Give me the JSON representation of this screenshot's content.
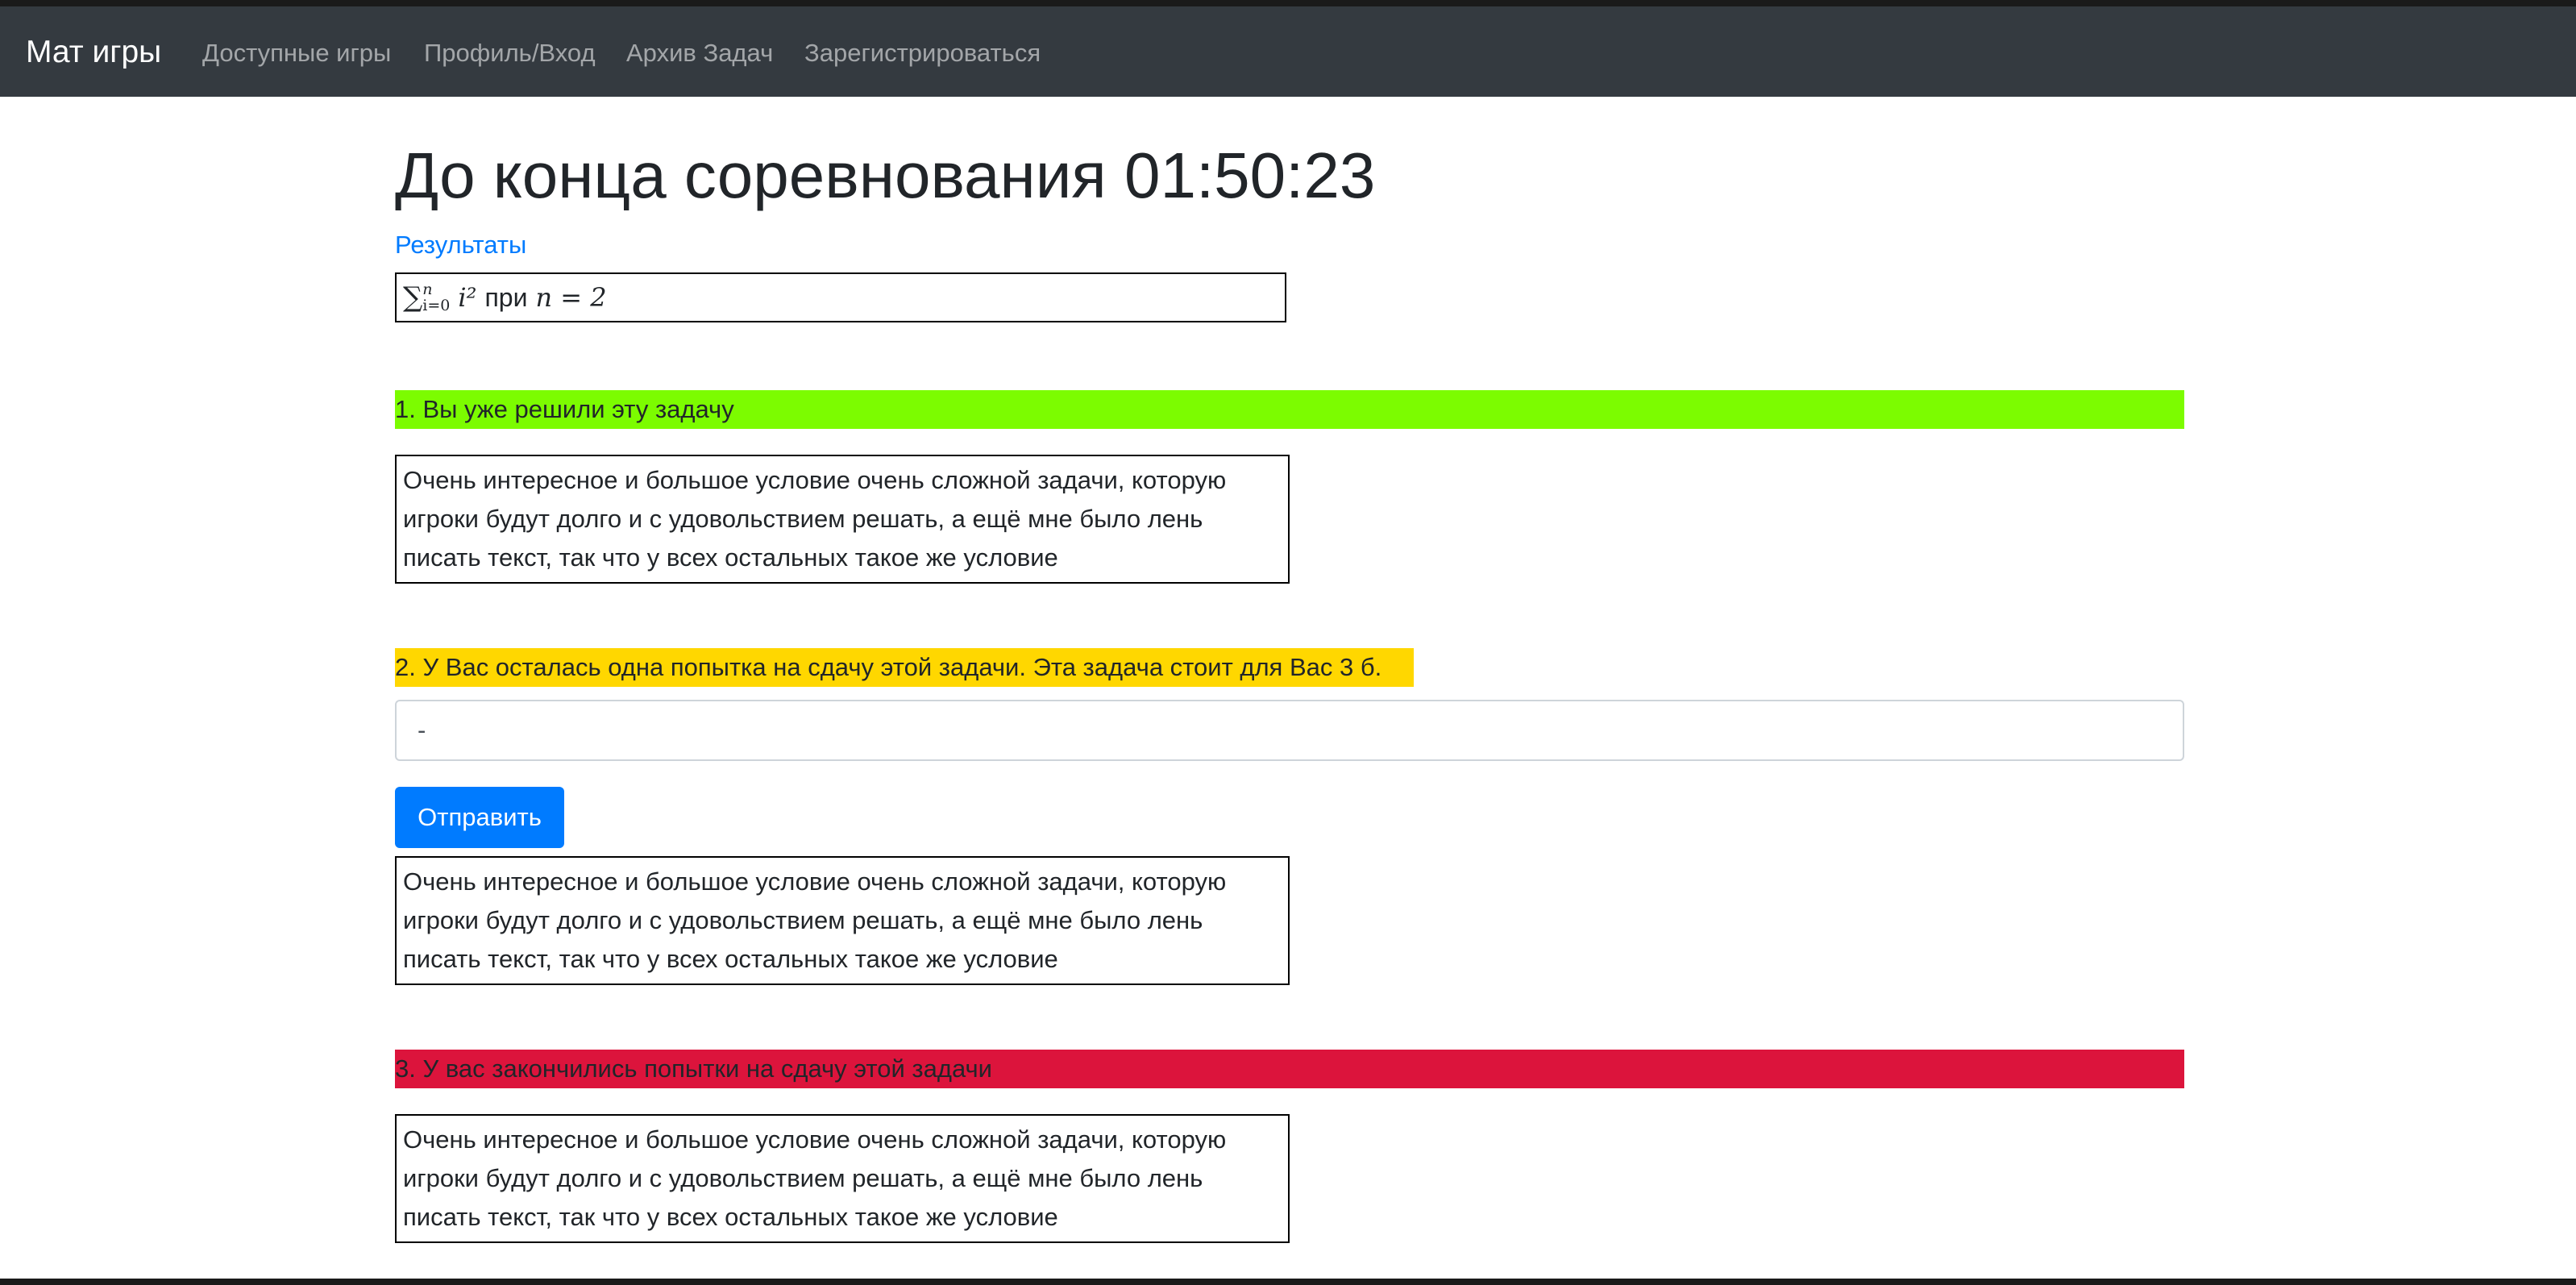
{
  "navbar": {
    "brand": "Мат игры",
    "links": [
      "Доступные игры",
      "Профиль/Вход",
      "Архив Задач",
      "Зарегистрироваться"
    ]
  },
  "countdown": {
    "label": "До конца соревнования 01:50:23"
  },
  "results_link": "Результаты",
  "formula": {
    "sigma": "∑",
    "upper": "n",
    "lower": "i=0",
    "term": "i²",
    "mid": "при",
    "condition": "n = 2"
  },
  "tasks": [
    {
      "status": "1. Вы уже решили эту задачу",
      "status_color": "#7cfc00",
      "text": "Очень интересное и большое условие очень сложной задачи, которую игроки будут долго и с удовольствием решать, а ещё мне было лень писать текст, так что у всех остальных такое же условие"
    },
    {
      "status": "2. У Вас осталась одна попытка на сдачу этой задачи. Эта задача стоит для Вас 3 б.",
      "status_color": "#ffd700",
      "answer_value": "-",
      "submit_label": "Отправить",
      "text": "Очень интересное и большое условие очень сложной задачи, которую игроки будут долго и с удовольствием решать, а ещё мне было лень писать текст, так что у всех остальных такое же условие"
    },
    {
      "status": "3. У вас закончились попытки на сдачу этой задачи",
      "status_color": "#dc143c",
      "text": "Очень интересное и большое условие очень сложной задачи, которую игроки будут долго и с удовольствием решать, а ещё мне было лень писать текст, так что у всех остальных такое же условие"
    }
  ]
}
